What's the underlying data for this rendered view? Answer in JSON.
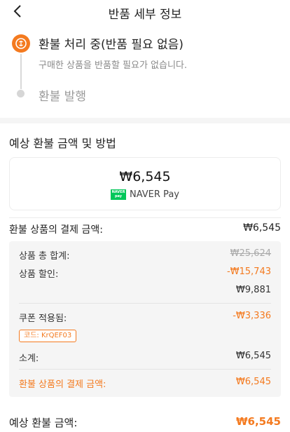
{
  "header": {
    "title": "반품 세부 정보"
  },
  "status": {
    "step1_title": "환불 처리 중(반품 필요 없음)",
    "step1_desc": "구매한 상품을 반품할 필요가 없습니다.",
    "step2_title": "환불 발행"
  },
  "refund": {
    "section_title": "예상 환불 금액 및 방법",
    "amount": "₩6,545",
    "method_logo": "NAVER pay",
    "method": "NAVER Pay",
    "paid_label": "환불 상품의 결제 금액:",
    "paid_value": "₩6,545",
    "details": {
      "subtotal_label": "상품 총 합계:",
      "subtotal_value": "₩25,624",
      "discount_label": "상품 할인:",
      "discount_value": "-₩15,743",
      "after_discount_value": "₩9,881",
      "coupon_label": "쿠폰 적용됨:",
      "coupon_value": "-₩3,336",
      "coupon_code": "코드: KrQEF03",
      "sum_label": "소계:",
      "sum_value": "₩6,545",
      "paid_label": "환불 상품의 결제 금액:",
      "paid_value": "₩6,545"
    },
    "expected_label": "예상 환불 금액:",
    "expected_value": "₩6,545"
  },
  "colors": {
    "accent": "#f47a1f",
    "naver_green": "#03c75a"
  }
}
